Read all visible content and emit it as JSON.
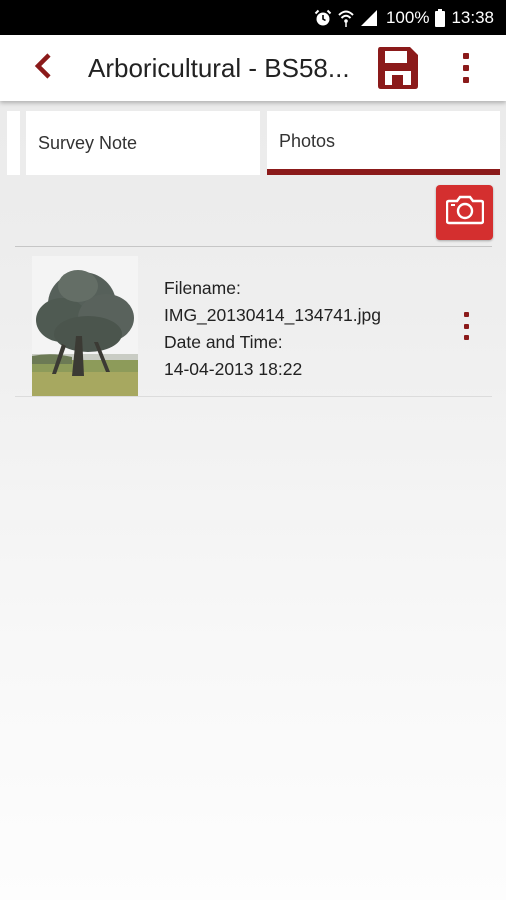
{
  "status_bar": {
    "battery_percent": "100%",
    "time": "13:38",
    "icons": [
      "alarm-icon",
      "wifi-icon",
      "signal-icon",
      "battery-icon"
    ]
  },
  "app_bar": {
    "title": "Arboricultural - BS58...",
    "icons": {
      "back": "chevron-left-icon",
      "save": "floppy-disk-icon",
      "more": "more-vertical-icon"
    }
  },
  "tabs": [
    {
      "label": "Survey Note",
      "selected": false
    },
    {
      "label": "Photos",
      "selected": true
    }
  ],
  "camera_button": {
    "icon": "camera-icon"
  },
  "photos": [
    {
      "filename_label": "Filename:",
      "filename": "IMG_20130414_134741.jpg",
      "datetime_label": "Date and Time:",
      "datetime": "14-04-2013 18:22"
    }
  ],
  "colors": {
    "accent": "#8b1a1a",
    "camera_button": "#d42f2f",
    "status_bar": "#000000"
  }
}
